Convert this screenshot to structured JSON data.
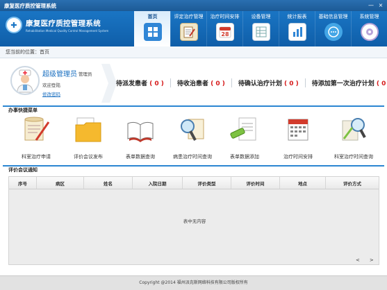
{
  "window": {
    "title": "康复医疗质控管理系统",
    "buttons": {
      "minimize": "—",
      "close": "×"
    }
  },
  "brand": {
    "name": "康复医疗质控管理系统",
    "subtitle": "Rehabilitation Medical Quality Control Management System",
    "accent": "#1a75c4"
  },
  "nav": [
    {
      "label": "首页",
      "icon": "home-icon",
      "active": true
    },
    {
      "label": "评定治疗管理",
      "icon": "clipboard-pencil-icon",
      "active": false
    },
    {
      "label": "治疗时间安排",
      "icon": "calendar-icon",
      "active": false
    },
    {
      "label": "设备管理",
      "icon": "grid-list-icon",
      "active": false
    },
    {
      "label": "统计报表",
      "icon": "bar-chart-icon",
      "active": false
    },
    {
      "label": "基础信息管理",
      "icon": "info-chat-icon",
      "active": false
    },
    {
      "label": "系统管理",
      "icon": "settings-gear-icon",
      "active": false
    }
  ],
  "breadcrumb": "您当前的位置：首页",
  "user": {
    "name": "超级管理员",
    "role": "管理员",
    "welcome": "欢迎登陆",
    "change_password": "修改密码"
  },
  "stats": [
    {
      "label": "待派发患者",
      "value": "( 0 )"
    },
    {
      "label": "待收治患者",
      "value": "( 0 )"
    },
    {
      "label": "待确认治疗计划",
      "value": "( 0 )"
    },
    {
      "label": "待添加第一次治疗计划",
      "value": "( 0 )"
    }
  ],
  "quick_menu": {
    "title": "办事快捷菜单",
    "items": [
      {
        "label": "科室治疗申请",
        "icon": "scroll-pen-icon"
      },
      {
        "label": "评价会议发布",
        "icon": "folder-document-icon"
      },
      {
        "label": "表单数据查询",
        "icon": "open-book-icon"
      },
      {
        "label": "病患治疗时间查询",
        "icon": "magnifier-document-icon"
      },
      {
        "label": "表单数据添加",
        "icon": "document-marker-icon"
      },
      {
        "label": "治疗时间安排",
        "icon": "calendar-pages-icon"
      },
      {
        "label": "科室治疗时间查询",
        "icon": "magnifier-pencil-icon"
      }
    ]
  },
  "meetings": {
    "title": "评价会议通知",
    "columns": [
      "序号",
      "病区",
      "姓名",
      "入院日期",
      "评价类型",
      "评价时间",
      "地点",
      "评价方式"
    ],
    "empty_text": "表中无内容",
    "pager": {
      "prev": "<",
      "next": ">"
    }
  },
  "footer": "Copyright @2014 福州派克斯网络科技有限公司版权所有"
}
